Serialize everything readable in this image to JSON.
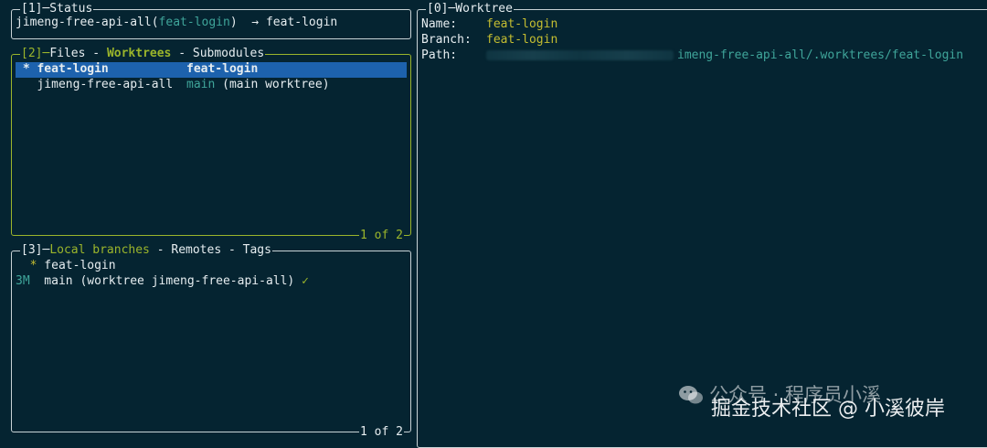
{
  "status_panel": {
    "title": "[1]─Status",
    "repo": "jimeng-free-api-all",
    "branch_ref": "feat-login",
    "arrow": ")  → ",
    "target": "feat-login"
  },
  "files_panel": {
    "prefix": "[2]─",
    "tab_files": "Files",
    "sep1": " - ",
    "tab_worktrees": "Worktrees",
    "sep2": " - ",
    "tab_submodules": "Submodules",
    "rows": [
      {
        "marker": " * ",
        "name": "feat-login",
        "branch": "feat-login",
        "note": ""
      },
      {
        "marker": "   ",
        "name": "jimeng-free-api-all",
        "branch": "main",
        "note": " (main worktree)"
      }
    ],
    "footer": "1 of 2"
  },
  "branches_panel": {
    "prefix": "[3]─",
    "tab_local": "Local branches",
    "sep1": " - ",
    "tab_remotes": "Remotes",
    "sep2": " - ",
    "tab_tags": "Tags",
    "rows": [
      {
        "status": "  *",
        "text": " feat-login",
        "check": ""
      },
      {
        "status": "3M ",
        "text": " main (worktree jimeng-free-api-all) ",
        "check": "✓"
      }
    ],
    "footer": "1 of 2"
  },
  "worktree_panel": {
    "title": "[0]─Worktree",
    "name_label": "Name:",
    "name_value": "feat-login",
    "branch_label": "Branch:",
    "branch_value": "feat-login",
    "path_label": "Path:",
    "path_value": "imeng-free-api-all/.worktrees/feat-login"
  },
  "watermark": {
    "line1": "公众号 · 程序员小溪",
    "line2": "掘金技术社区 @ 小溪彼岸",
    "icon": "wechat-icon"
  },
  "colors": {
    "background": "#052431",
    "active_border": "#9bb52b",
    "selection": "#1d62ad",
    "teal": "#3fa59a",
    "yellow": "#c4bd31"
  }
}
